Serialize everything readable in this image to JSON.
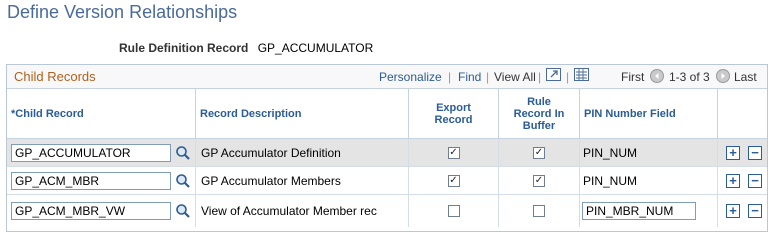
{
  "page_title": "Define Version Relationships",
  "rule_definition": {
    "label": "Rule Definition Record",
    "value": "GP_ACCUMULATOR"
  },
  "grid": {
    "title": "Child Records",
    "personalize": "Personalize",
    "sep": "|",
    "find": "Find",
    "view_all": "View All",
    "first": "First",
    "range": "1-3 of 3",
    "last": "Last",
    "columns": {
      "child_record": "*Child Record",
      "record_description": "Record Description",
      "export_record": "Export Record",
      "rule_record_in_buffer": "Rule Record In Buffer",
      "pin_number_field": "PIN Number Field"
    },
    "rows": [
      {
        "child_record": "GP_ACCUMULATOR",
        "description": "GP Accumulator Definition",
        "export": "✓",
        "buffer": "✓",
        "pin": "PIN_NUM"
      },
      {
        "child_record": "GP_ACM_MBR",
        "description": "GP Accumulator Members",
        "export": "✓",
        "buffer": "✓",
        "pin": "PIN_NUM"
      },
      {
        "child_record": "GP_ACM_MBR_VW",
        "description": "View of Accumulator Member rec",
        "export": "",
        "buffer": "",
        "pin": "PIN_MBR_NUM"
      }
    ],
    "add_glyph": "+",
    "delete_glyph": "−"
  },
  "colors": {
    "title": "#4a6a99",
    "link": "#2a5c96",
    "grid_title": "#b35f1d"
  }
}
